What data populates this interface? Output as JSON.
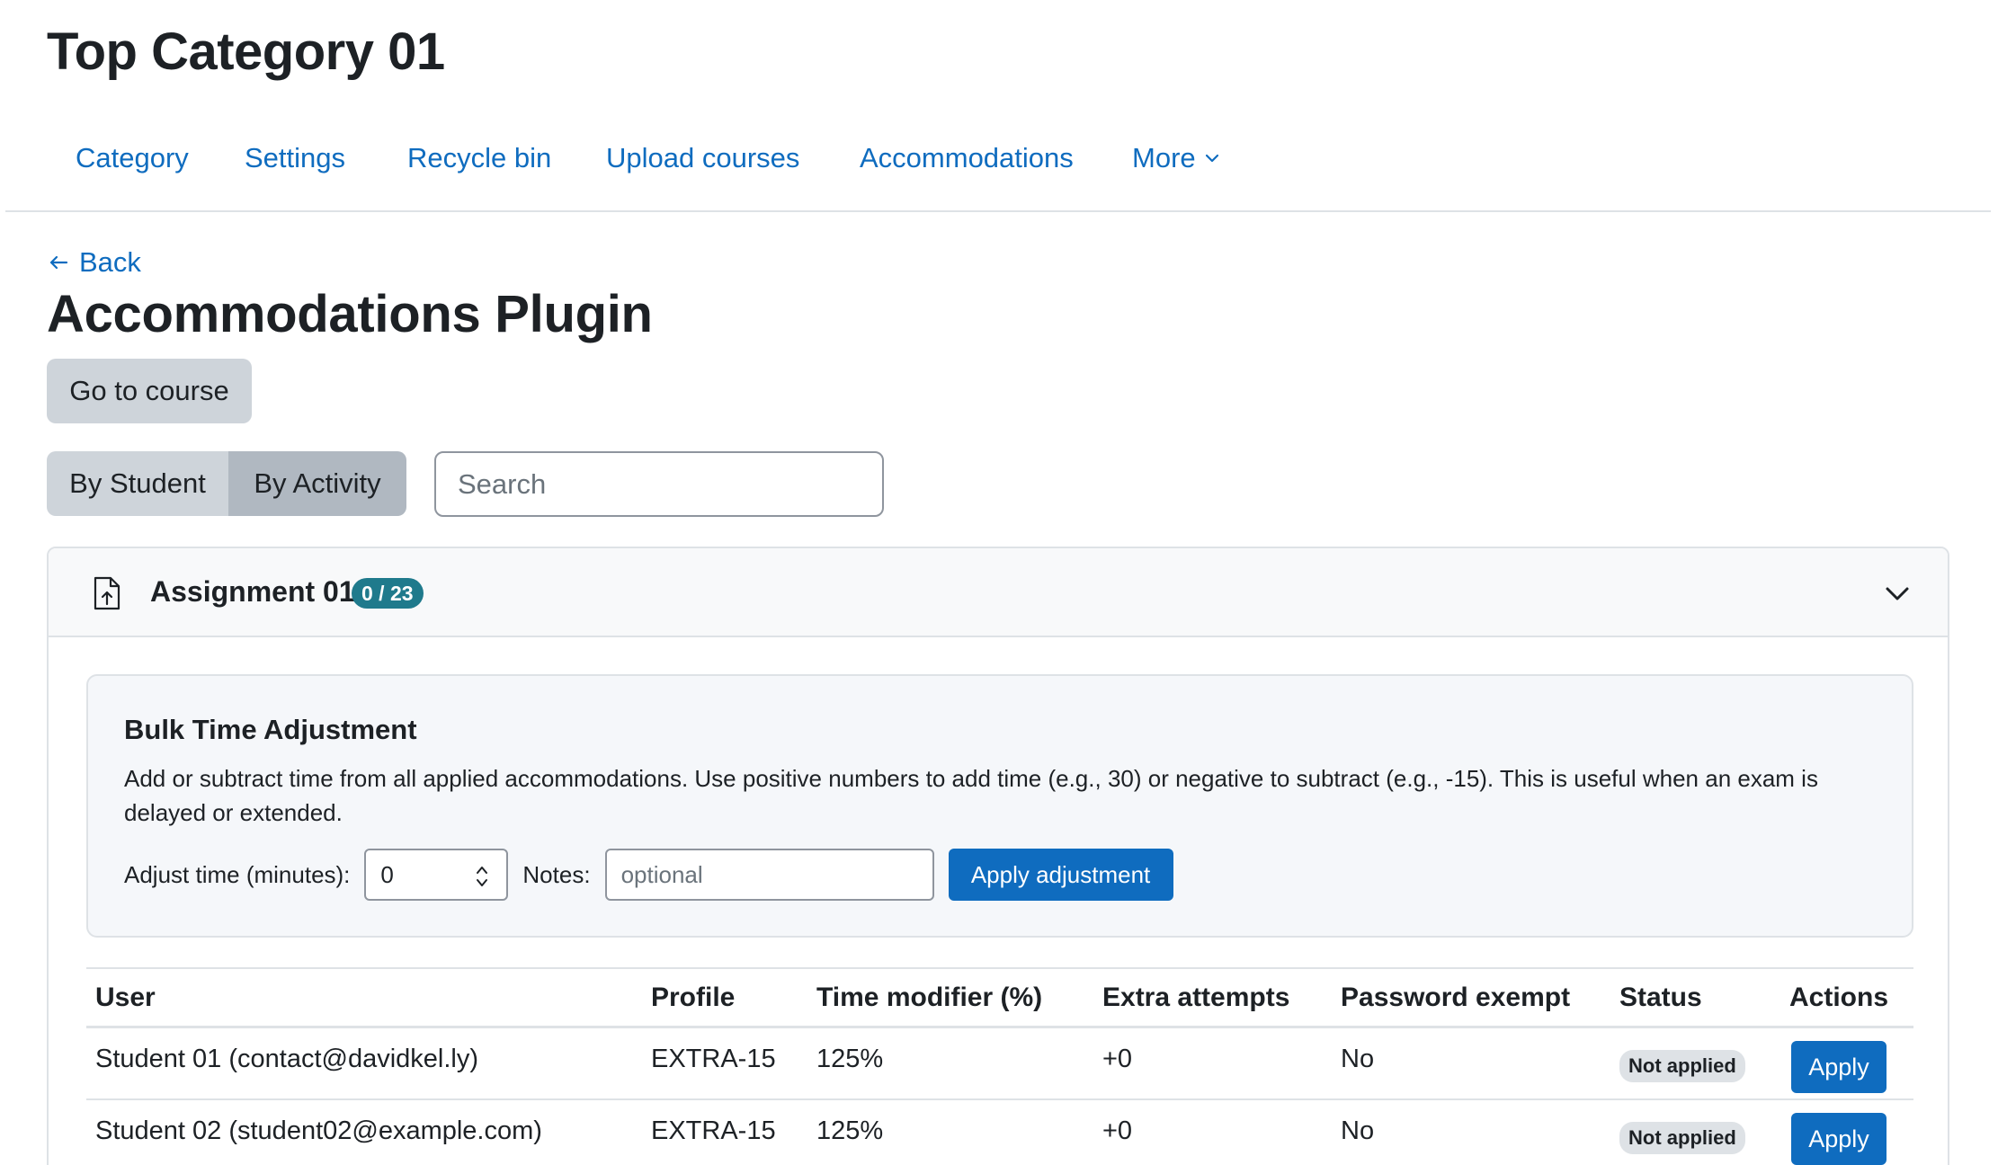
{
  "page": {
    "title": "Top Category 01"
  },
  "nav": {
    "items": [
      "Category",
      "Settings",
      "Recycle bin",
      "Upload courses",
      "Accommodations"
    ],
    "more_label": "More"
  },
  "back_label": "Back",
  "heading": "Accommodations Plugin",
  "go_to_course_label": "Go to course",
  "view_toggle": {
    "by_student": "By Student",
    "by_activity": "By Activity",
    "selected": "By Activity"
  },
  "search": {
    "placeholder": "Search",
    "value": ""
  },
  "activity": {
    "icon": "assignment-upload-icon",
    "title": "Assignment 01",
    "count_badge": "0 / 23"
  },
  "bulk": {
    "title": "Bulk Time Adjustment",
    "description": "Add or subtract time from all applied accommodations. Use positive numbers to add time (e.g., 30) or negative to subtract (e.g., -15). This is useful when an exam is delayed or extended.",
    "adjust_label": "Adjust time (minutes):",
    "adjust_value": "0",
    "notes_label": "Notes:",
    "notes_placeholder": "optional",
    "apply_label": "Apply adjustment"
  },
  "table": {
    "headers": {
      "user": "User",
      "profile": "Profile",
      "time_modifier": "Time modifier (%)",
      "extra_attempts": "Extra attempts",
      "password_exempt": "Password exempt",
      "status": "Status",
      "actions": "Actions"
    },
    "rows": [
      {
        "user": "Student 01 (contact@davidkel.ly)",
        "profile": "EXTRA-15",
        "time_modifier": "125%",
        "extra_attempts": "+0",
        "password_exempt": "No",
        "status": "Not applied",
        "action": "Apply"
      },
      {
        "user": "Student 02 (student02@example.com)",
        "profile": "EXTRA-15",
        "time_modifier": "125%",
        "extra_attempts": "+0",
        "password_exempt": "No",
        "status": "Not applied",
        "action": "Apply"
      }
    ]
  },
  "colors": {
    "link": "#0f6cbf",
    "primary": "#0f6cbf",
    "badge": "#1f7a8c",
    "border": "#dee2e6"
  }
}
